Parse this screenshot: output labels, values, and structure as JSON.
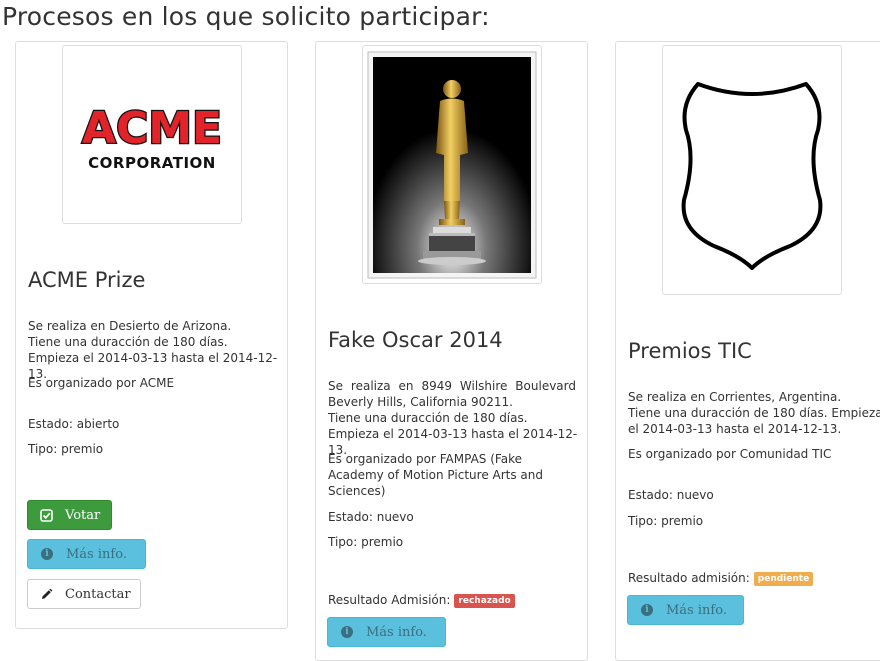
{
  "page": {
    "title": "Procesos en los que solicito participar:"
  },
  "cards": [
    {
      "title": "ACME Prize",
      "image_alt": "ACME CORPORATION logo",
      "logo": {
        "line1": "ACME",
        "line2": "CORPORATION"
      },
      "location": "Se realiza en Desierto de Arizona.",
      "duration": "Tiene una duracción de 180 días. Empieza el 2014-03-13 hasta el 2014-12-13.",
      "organizer": "Es organizado por ACME",
      "status": "Estado: abierto",
      "type": "Tipo: premio",
      "buttons": {
        "vote": "Votar",
        "info": "Más info.",
        "contact": "Contactar"
      }
    },
    {
      "title": "Fake Oscar 2014",
      "image_alt": "Golden statuette trophy",
      "location": "Se realiza en 8949 Wilshire Boulevard Beverly Hills, California 90211.",
      "duration": "Tiene una duracción de 180 días. Empieza el 2014-03-13 hasta el 2014-12-13.",
      "organizer": "Es organizado por FAMPAS (Fake Academy of Motion Picture Arts and Sciences)",
      "status": "Estado: nuevo",
      "type": "Tipo: premio",
      "admission_label": "Resultado Admisión:",
      "admission_badge": "rechazado",
      "buttons": {
        "info": "Más info."
      }
    },
    {
      "title": "Premios TIC",
      "image_alt": "Empty shield emblem",
      "location": "Se realiza en Corrientes, Argentina.",
      "duration": "Tiene una duracción de 180 días. Empieza el 2014-03-13 hasta el 2014-12-13.",
      "organizer": "Es organizado por Comunidad TIC",
      "status": "Estado: nuevo",
      "type": "Tipo: premio",
      "admission_label": "Resultado admisión:",
      "admission_badge": "pendiente",
      "buttons": {
        "info": "Más info."
      }
    }
  ],
  "colors": {
    "success": "#3d9b3d",
    "info": "#5bc0de",
    "danger": "#d9534f",
    "warning": "#f0ad4e",
    "acme_red": "#e2232a"
  },
  "icons": [
    "check-square-icon",
    "info-circle-icon",
    "pencil-icon",
    "trophy-image",
    "shield-image"
  ]
}
